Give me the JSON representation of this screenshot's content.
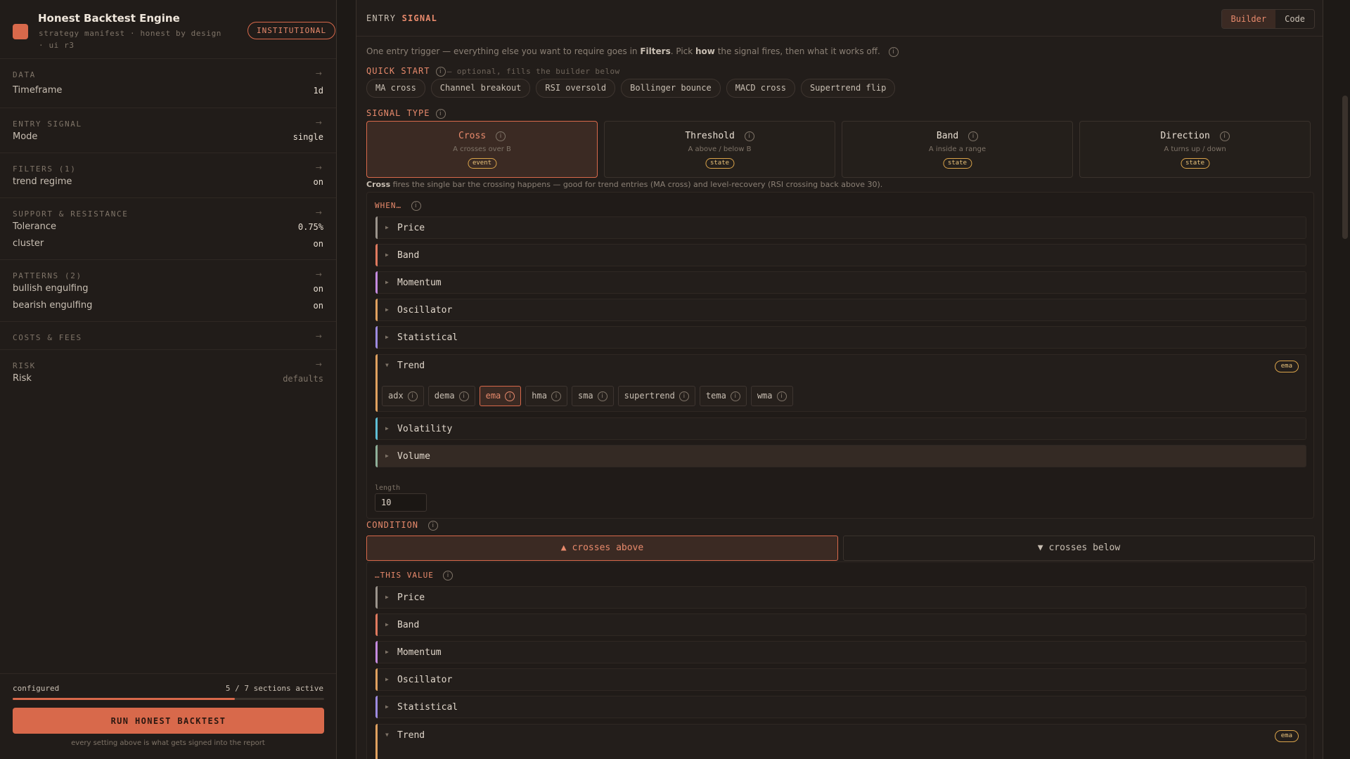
{
  "app": {
    "title": "Honest Backtest Engine",
    "subtitle": "strategy manifest · honest by design · ui r3",
    "badge": "INSTITUTIONAL"
  },
  "sidebar": {
    "sections": [
      {
        "head": "DATA",
        "rows": [
          {
            "label": "Timeframe",
            "value": "1d"
          }
        ]
      },
      {
        "head": "ENTRY SIGNAL",
        "rows": [
          {
            "label": "Mode",
            "value": "single"
          }
        ]
      },
      {
        "head": "FILTERS (1)",
        "rows": [
          {
            "label": "trend regime",
            "value": "on"
          }
        ]
      },
      {
        "head": "SUPPORT & RESISTANCE",
        "rows": [
          {
            "label": "Tolerance",
            "value": "0.75%"
          },
          {
            "label": "cluster",
            "value": "on"
          }
        ]
      },
      {
        "head": "PATTERNS (2)",
        "rows": [
          {
            "label": "bullish engulfing",
            "value": "on"
          },
          {
            "label": "bearish engulfing",
            "value": "on"
          }
        ]
      },
      {
        "head": "COSTS & FEES",
        "rows": []
      },
      {
        "head": "RISK",
        "rows": [
          {
            "label": "Risk",
            "value": "defaults"
          }
        ]
      }
    ],
    "arrow": "→",
    "footer": {
      "configured": "configured",
      "count": "5 / 7 sections active",
      "progress": 0.714,
      "run_label": "RUN HONEST BACKTEST",
      "note": "every setting above is what gets signed into the report"
    }
  },
  "main": {
    "title_prefix": "ENTRY",
    "title_accent": "SIGNAL",
    "toggle": {
      "builder": "Builder",
      "code": "Code"
    },
    "intro": {
      "a": "One entry trigger — everything else you want to require goes in ",
      "b": "Filters",
      "c": ". Pick ",
      "d": "how",
      "e": " the signal fires, then what it works off."
    },
    "quick_start": {
      "label": "QUICK START",
      "hint": "— optional, fills the builder below",
      "chips": [
        "MA cross",
        "Channel breakout",
        "RSI oversold",
        "Bollinger bounce",
        "MACD cross",
        "Supertrend flip"
      ]
    },
    "signal_type": {
      "label": "SIGNAL TYPE",
      "cards": [
        {
          "name": "Cross",
          "desc": "A crosses over B",
          "tag": "event"
        },
        {
          "name": "Threshold",
          "desc": "A above / below B",
          "tag": "state"
        },
        {
          "name": "Band",
          "desc": "A inside a range",
          "tag": "state"
        },
        {
          "name": "Direction",
          "desc": "A turns up / down",
          "tag": "state"
        }
      ],
      "explain_bold": "Cross",
      "explain_rest": " fires the single bar the crossing happens — good for trend entries (MA cross) and level-recovery (RSI crossing back above 30)."
    },
    "when": {
      "label": "WHEN…",
      "categories": [
        "Price",
        "Band",
        "Momentum",
        "Oscillator",
        "Statistical",
        "Trend",
        "Volatility",
        "Volume"
      ],
      "trend_pill": "ema",
      "trend_indicators": [
        "adx",
        "dema",
        "ema",
        "hma",
        "sma",
        "supertrend",
        "tema",
        "wma"
      ],
      "param_label": "length",
      "param_value": "10"
    },
    "condition": {
      "label": "CONDITION",
      "above": "▲ crosses above",
      "below": "▼ crosses below"
    },
    "this_value": {
      "label": "…THIS VALUE",
      "categories": [
        "Price",
        "Band",
        "Momentum",
        "Oscillator",
        "Statistical",
        "Trend"
      ],
      "trend_pill": "ema"
    }
  },
  "colors": {
    "accent": "#d8694b",
    "price": "#9b948c",
    "band": "#e07a5f",
    "momentum": "#c58be0",
    "oscillator": "#e0a15f",
    "statistical": "#9d8be0",
    "trend": "#e0a15f",
    "volatility": "#5fbfd6",
    "volume": "#8fb09a"
  }
}
